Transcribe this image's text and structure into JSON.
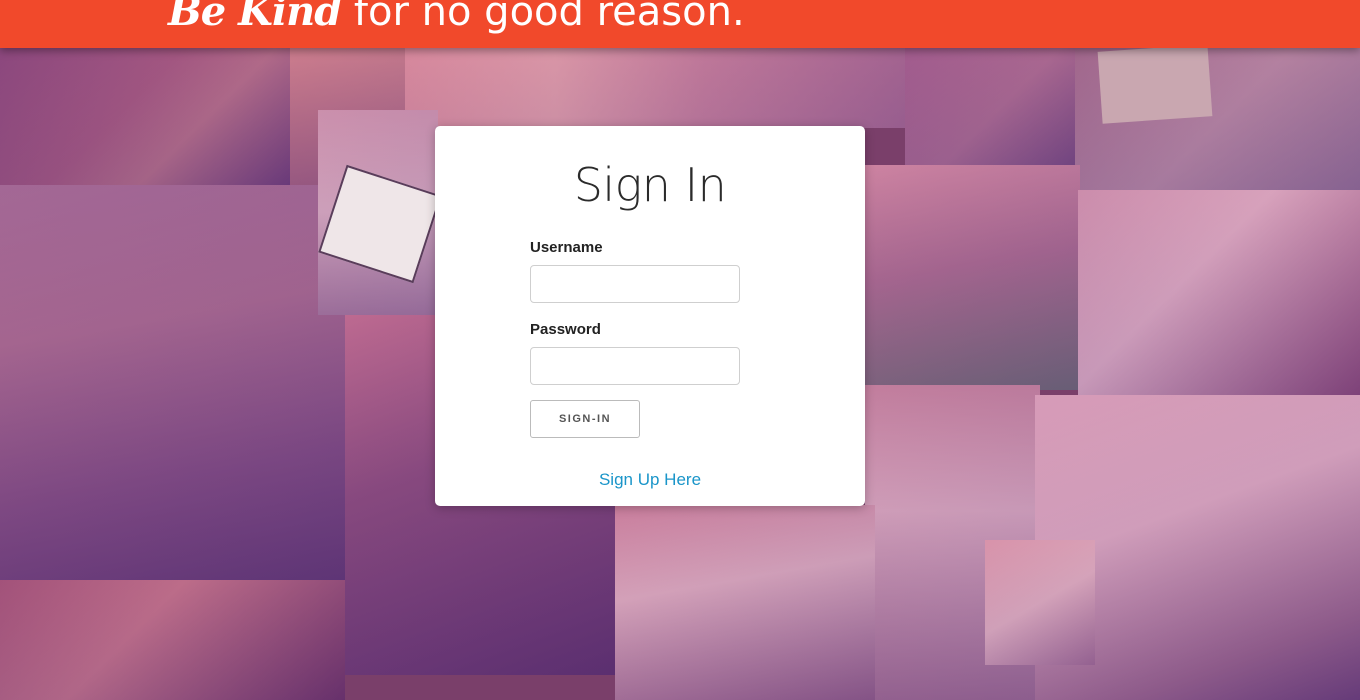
{
  "header": {
    "brand": "Be Kind",
    "tagline_rest": " for no good reason."
  },
  "signin": {
    "title": "Sign In",
    "username_label": "Username",
    "username_value": "",
    "password_label": "Password",
    "password_value": "",
    "submit_label": "SIGN-IN",
    "signup_link": "Sign Up Here"
  },
  "colors": {
    "header_bg": "#f1492b",
    "link": "#1a95c9"
  }
}
